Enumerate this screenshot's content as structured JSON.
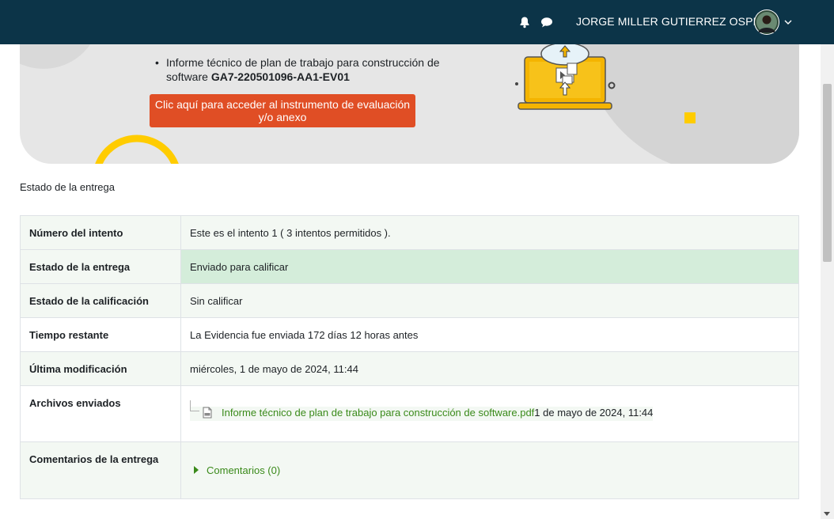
{
  "navbar": {
    "user_name": "JORGE MILLER GUTIERREZ OSPINA",
    "icons": [
      "bell-icon",
      "chat-icon",
      "avatar",
      "chevron-down-icon"
    ]
  },
  "banner": {
    "item_text": "Informe técnico de plan de trabajo para construcción de software ",
    "item_code": "GA7-220501096-AA1-EV01",
    "button_label": "Clic aquí para acceder al instrumento de evaluación y/o anexo",
    "colors": {
      "button": "#e04e25",
      "accent_yellow": "#ffcc00",
      "background": "#e6e6e6"
    }
  },
  "section": {
    "title": "Estado de la entrega"
  },
  "status": {
    "attempt_label": "Número del intento",
    "attempt_value": "Este es el intento 1 ( 3 intentos permitidos ).",
    "submission_label": "Estado de la entrega",
    "submission_value": "Enviado para calificar",
    "grading_label": "Estado de la calificación",
    "grading_value": "Sin calificar",
    "time_label": "Tiempo restante",
    "time_value": "La Evidencia fue enviada 172 días 12 horas antes",
    "modified_label": "Última modificación",
    "modified_value": "miércoles, 1 de mayo de 2024, 11:44",
    "files_label": "Archivos enviados",
    "file_name": "Informe técnico de plan de trabajo para construcción de software.pdf",
    "file_date": "1 de mayo de 2024, 11:44",
    "comments_label": "Comentarios de la entrega",
    "comments_toggle": "Comentarios (0)",
    "colors": {
      "green_row": "#d4edda",
      "light_row": "#f3f8f3",
      "link": "#3a8a1a"
    }
  }
}
